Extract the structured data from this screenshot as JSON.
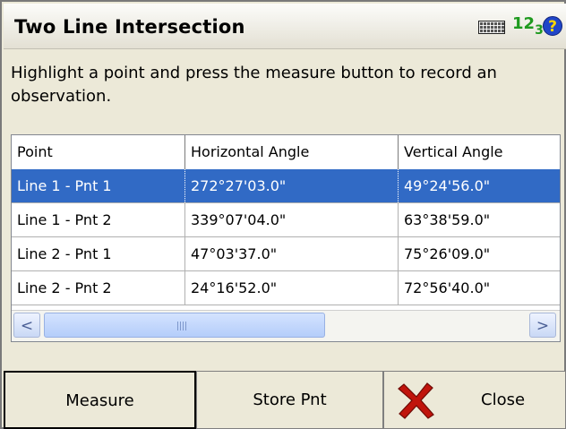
{
  "window": {
    "title": "Two Line Intersection",
    "icons": [
      "keyboard-icon",
      "numeric-input-icon",
      "help-icon"
    ],
    "numeric_glyph_major": "1",
    "numeric_glyph_minor": "2",
    "numeric_glyph_tail": "3",
    "help_glyph": "?"
  },
  "instructions": "Highlight a point and press the measure button to record an observation.",
  "table": {
    "columns": [
      "Point",
      "Horizontal Angle",
      "Vertical Angle"
    ],
    "rows": [
      {
        "point": "Line 1 - Pnt 1",
        "horizontal": "272°27'03.0\"",
        "vertical": "49°24'56.0\"",
        "selected": true
      },
      {
        "point": "Line 1 - Pnt 2",
        "horizontal": "339°07'04.0\"",
        "vertical": "63°38'59.0\"",
        "selected": false
      },
      {
        "point": "Line 2 - Pnt 1",
        "horizontal": "47°03'37.0\"",
        "vertical": "75°26'09.0\"",
        "selected": false
      },
      {
        "point": "Line 2 - Pnt 2",
        "horizontal": "24°16'52.0\"",
        "vertical": "72°56'40.0\"",
        "selected": false
      }
    ],
    "scroll_left": "<",
    "scroll_right": ">"
  },
  "buttons": {
    "measure": "Measure",
    "store": "Store Pnt",
    "close": "Close"
  },
  "colors": {
    "selection": "#316ac5",
    "close_x": "#c0140c",
    "numeric_glyph": "#1f9a1f",
    "help": "#2046c8"
  }
}
